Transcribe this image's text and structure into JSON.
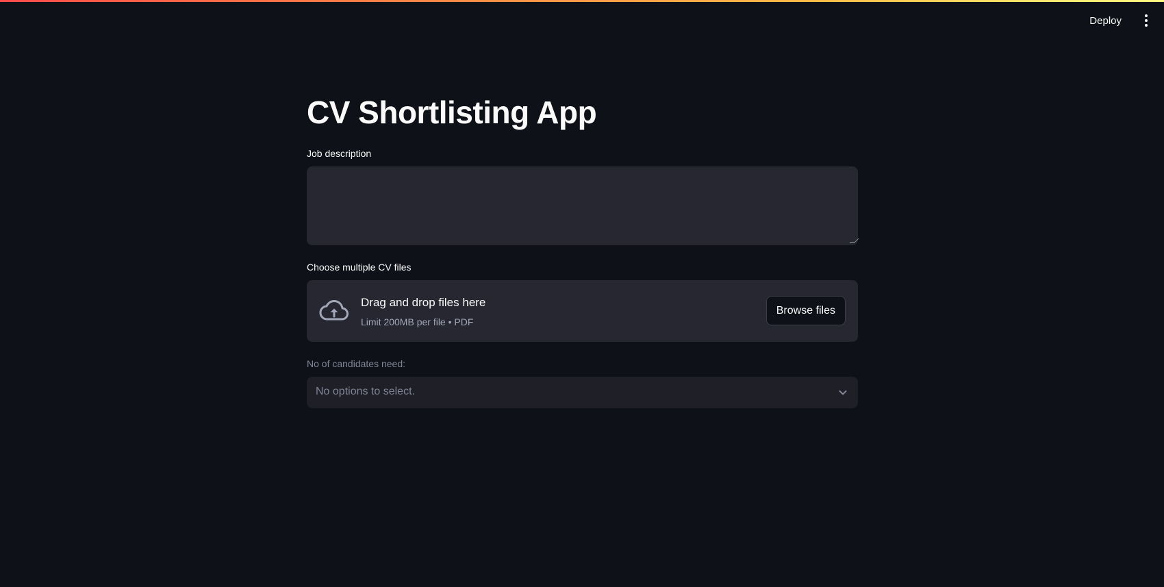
{
  "header": {
    "deploy_label": "Deploy",
    "menu_icon": "more-vertical-icon"
  },
  "main": {
    "title": "CV Shortlisting App",
    "job_description": {
      "label": "Job description",
      "value": ""
    },
    "cv_upload": {
      "label": "Choose multiple CV files",
      "icon": "cloud-upload-icon",
      "drop_text": "Drag and drop files here",
      "limit_text": "Limit 200MB per file • PDF",
      "browse_label": "Browse files"
    },
    "candidates": {
      "label": "No of candidates need:",
      "placeholder": "No options to select.",
      "icon": "chevron-down-icon",
      "disabled": true
    }
  },
  "colors": {
    "background": "#0e1117",
    "surface": "#262730",
    "text": "#fafafa",
    "muted_text": "#808495",
    "accent_gradient_start": "#ff4b4b",
    "accent_gradient_end": "#fffd80"
  }
}
